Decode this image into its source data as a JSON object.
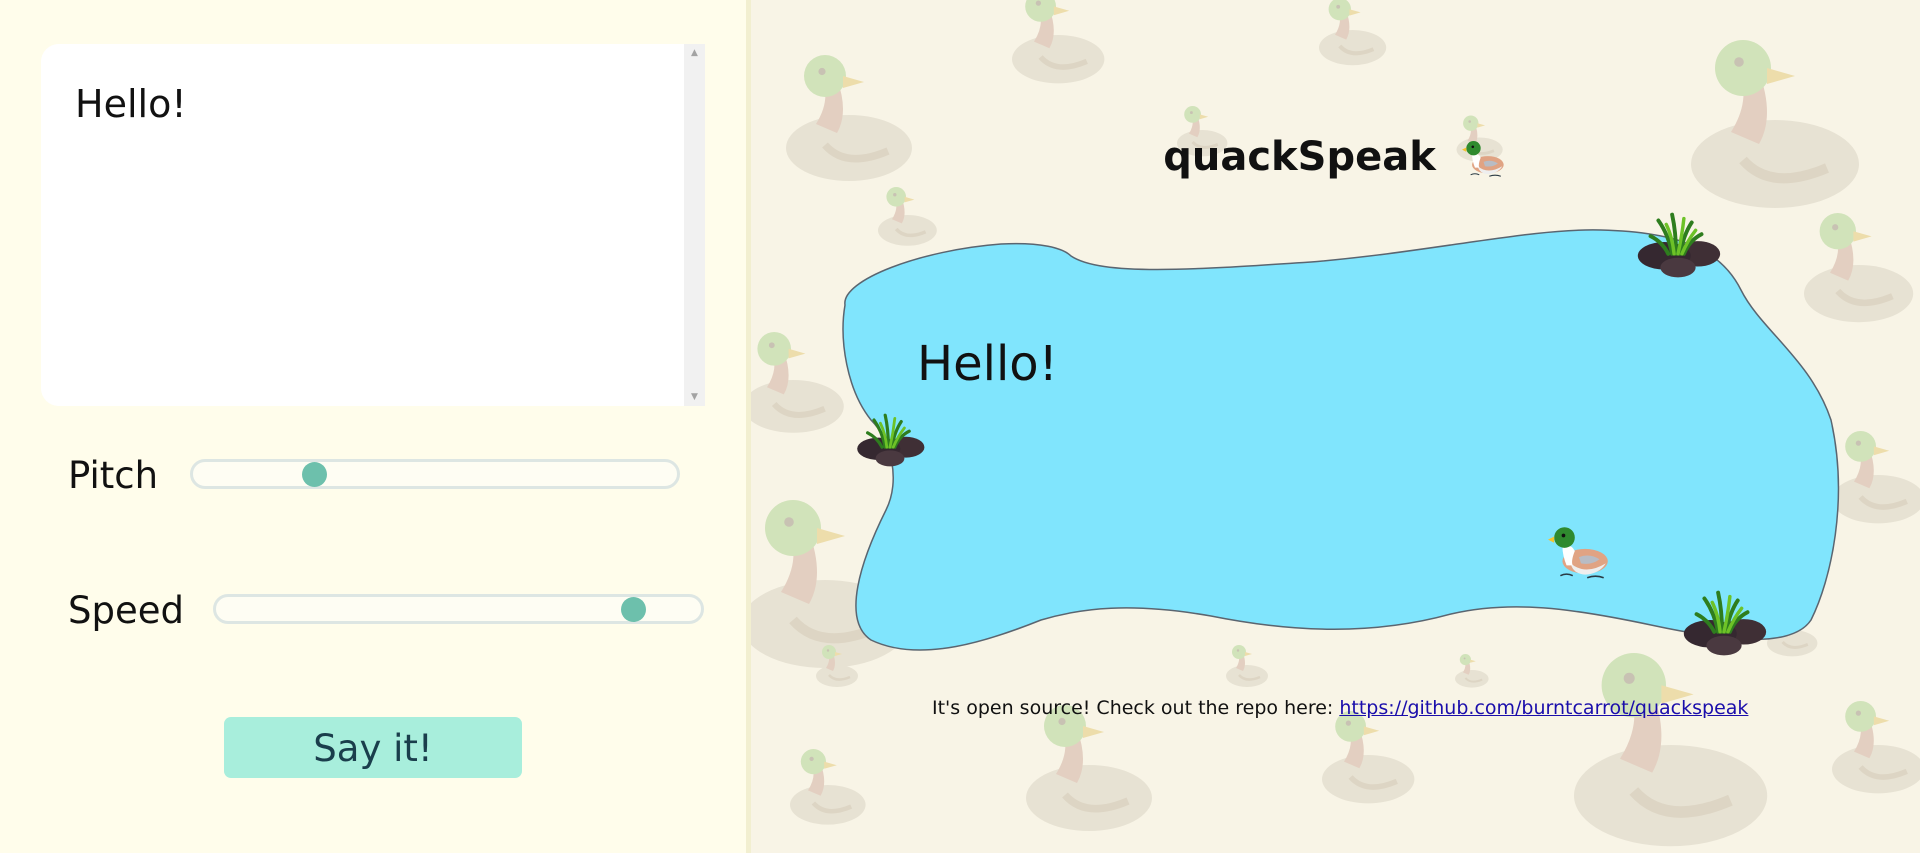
{
  "editor": {
    "text": "Hello!"
  },
  "controls": {
    "pitch": {
      "label": "Pitch",
      "value": 0.25
    },
    "speed": {
      "label": "Speed",
      "value": 0.86
    }
  },
  "action": {
    "say_label": "Say it!"
  },
  "header": {
    "title": "quackSpeak",
    "title_icon": "duck-emoji"
  },
  "pond": {
    "spoken_text": "Hello!",
    "icons": [
      "reeds-rock-icon",
      "duck-icon"
    ]
  },
  "footer": {
    "text": "It's open source! Check out the repo here: ",
    "link": "https://github.com/burntcarrot/quackspeak"
  },
  "colors": {
    "left_bg": "#fffdeb",
    "pond_water": "#80e5fd",
    "button_bg": "#a8eedc",
    "slider_thumb": "#6dc0ac"
  }
}
